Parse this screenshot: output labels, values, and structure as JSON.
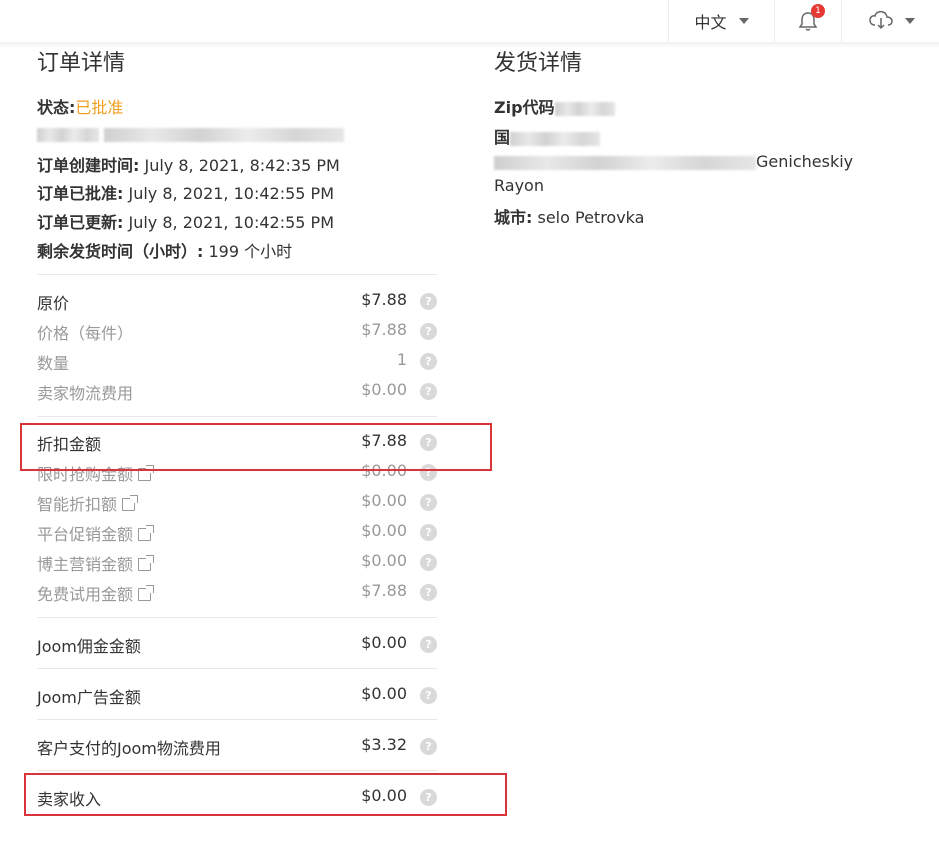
{
  "topbar": {
    "language": "中文",
    "notification_count": "1"
  },
  "order": {
    "title": "订单详情",
    "status_label": "状态:",
    "status_value": "已批准",
    "created_label": "订单创建时间:",
    "created_value": "July 8, 2021, 8:42:35 PM",
    "approved_label": "订单已批准:",
    "approved_value": "July 8, 2021, 10:42:55 PM",
    "updated_label": "订单已更新:",
    "updated_value": "July 8, 2021, 10:42:55 PM",
    "remaining_label": "剩余发货时间（小时）:",
    "remaining_value": "199 个小时"
  },
  "price_rows": [
    {
      "label": "原价",
      "value": "$7.88"
    },
    {
      "label": "价格（每件）",
      "value": "$7.88"
    },
    {
      "label": "数量",
      "value": "1"
    },
    {
      "label": "卖家物流费用",
      "value": "$0.00"
    }
  ],
  "discount_rows": [
    {
      "label": "折扣金额",
      "value": "$7.88"
    },
    {
      "label": "限时抢购金额",
      "value": "$0.00"
    },
    {
      "label": "智能折扣额",
      "value": "$0.00"
    },
    {
      "label": "平台促销金额",
      "value": "$0.00"
    },
    {
      "label": "博主营销金额",
      "value": "$0.00"
    },
    {
      "label": "免费试用金额",
      "value": "$7.88"
    }
  ],
  "fee_rows": [
    {
      "label": "Joom佣金金额",
      "value": "$0.00"
    },
    {
      "label": "Joom广告金额",
      "value": "$0.00"
    },
    {
      "label": "客户支付的Joom物流费用",
      "value": "$3.32"
    },
    {
      "label": "卖家收入",
      "value": "$0.00"
    }
  ],
  "shipping": {
    "title": "发货详情",
    "zip_label": "Zip代码",
    "country_label": "国",
    "region_value": "Genicheskiy",
    "region_value_2": "Rayon",
    "city_label": "城市:",
    "city_value": "selo Petrovka"
  },
  "colors": {
    "status_approved": "#f0a020",
    "highlight_box": "#d9343a"
  }
}
